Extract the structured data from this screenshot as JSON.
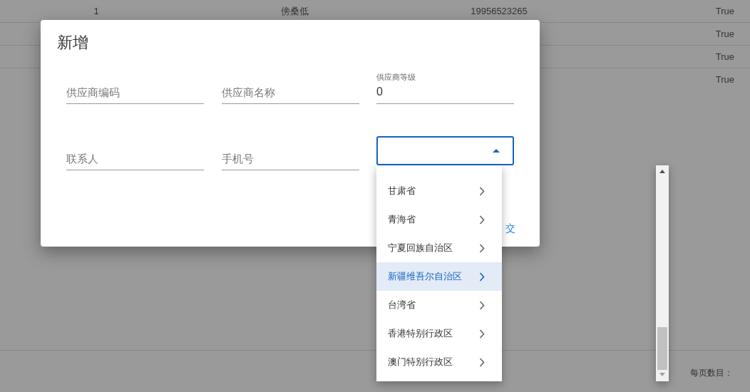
{
  "table": {
    "rows": [
      {
        "column_1": "1",
        "column_2": "傍桑低",
        "column_3": "19956523265",
        "column_4": "True"
      },
      {
        "column_4": "True"
      },
      {
        "column_4": "True"
      },
      {
        "column_4": "True"
      }
    ]
  },
  "footer": {
    "page_size_label": "每页数目："
  },
  "dialog": {
    "title": "新增",
    "fields": [
      {
        "kind": "input",
        "placeholder": "供应商编码"
      },
      {
        "kind": "input",
        "placeholder": "供应商名称"
      },
      {
        "kind": "labeled",
        "label": "供应商等级",
        "value": "0"
      },
      {
        "kind": "input",
        "placeholder": "联系人"
      },
      {
        "kind": "input",
        "placeholder": "手机号"
      },
      {
        "kind": "select",
        "expanded": true
      }
    ],
    "submit_button": "交"
  },
  "dropdown": {
    "items": [
      {
        "label": "甘肃省",
        "selected": false
      },
      {
        "label": "青海省",
        "selected": false
      },
      {
        "label": "宁夏回族自治区",
        "selected": false
      },
      {
        "label": "新疆维吾尔自治区",
        "selected": true
      },
      {
        "label": "台湾省",
        "selected": false
      },
      {
        "label": "香港特别行政区",
        "selected": false
      },
      {
        "label": "澳门特别行政区",
        "selected": false
      }
    ]
  }
}
